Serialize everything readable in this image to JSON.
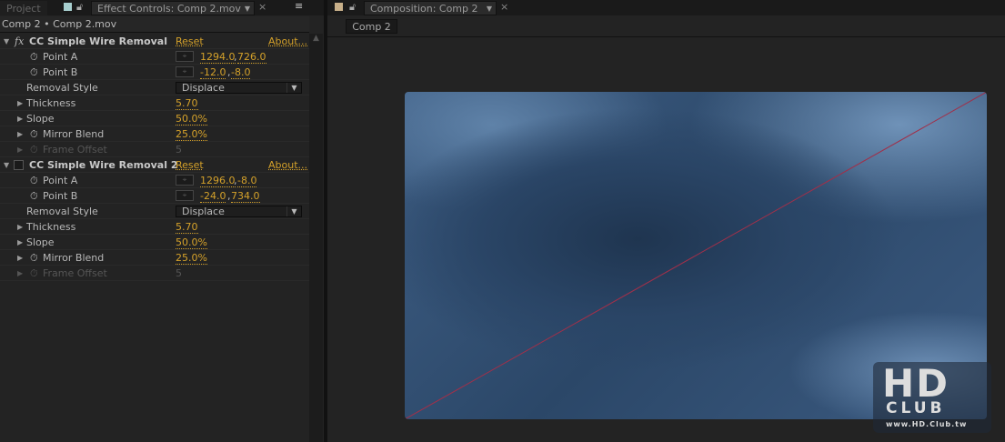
{
  "left_panel": {
    "project_tab": "Project",
    "effect_tab": "Effect Controls: Comp 2.mov",
    "breadcrumb": "Comp 2 • Comp 2.mov",
    "effects": [
      {
        "name": "CC Simple Wire Removal",
        "reset": "Reset",
        "about": "About...",
        "icon": "fx",
        "params": {
          "point_a_label": "Point A",
          "point_a_x": "1294.0",
          "point_a_y": "726.0",
          "point_b_label": "Point B",
          "point_b_x": "-12.0",
          "point_b_y": "-8.0",
          "removal_style_label": "Removal Style",
          "removal_style": "Displace",
          "thickness_label": "Thickness",
          "thickness": "5.70",
          "slope_label": "Slope",
          "slope": "50.0%",
          "mirror_blend_label": "Mirror Blend",
          "mirror_blend": "25.0%",
          "frame_offset_label": "Frame Offset",
          "frame_offset": "5"
        }
      },
      {
        "name": "CC Simple Wire Removal 2",
        "reset": "Reset",
        "about": "About...",
        "icon": "",
        "params": {
          "point_a_label": "Point A",
          "point_a_x": "1296.0",
          "point_a_y": "-8.0",
          "point_b_label": "Point B",
          "point_b_x": "-24.0",
          "point_b_y": "734.0",
          "removal_style_label": "Removal Style",
          "removal_style": "Displace",
          "thickness_label": "Thickness",
          "thickness": "5.70",
          "slope_label": "Slope",
          "slope": "50.0%",
          "mirror_blend_label": "Mirror Blend",
          "mirror_blend": "25.0%",
          "frame_offset_label": "Frame Offset",
          "frame_offset": "5"
        }
      }
    ]
  },
  "right_panel": {
    "composition_tab": "Composition: Comp 2",
    "comp_button": "Comp 2"
  },
  "watermark": {
    "logo": "HD CLUB",
    "url": "www.HD.Club.tw"
  },
  "colors": {
    "accent": "#d4a12a",
    "wire": "#a0304a"
  }
}
